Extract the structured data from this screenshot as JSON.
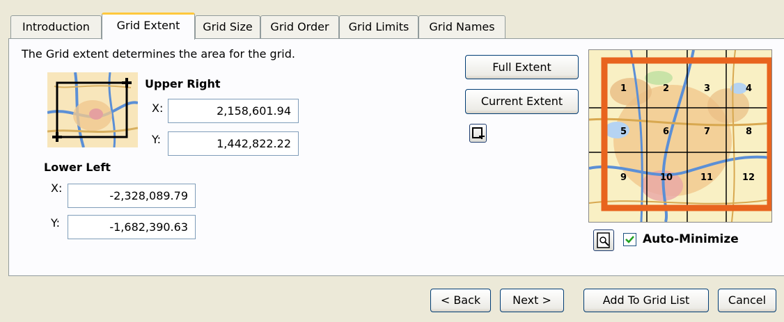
{
  "tabs": [
    "Introduction",
    "Grid Extent",
    "Grid Size",
    "Grid Order",
    "Grid Limits",
    "Grid Names"
  ],
  "active_tab": "Grid Extent",
  "description": "The Grid extent determines the area for the grid.",
  "upper_right": {
    "label": "Upper Right",
    "x_label": "X:",
    "x_value": "2,158,601.94",
    "y_label": "Y:",
    "y_value": "1,442,822.22"
  },
  "lower_left": {
    "label": "Lower Left",
    "x_label": "X:",
    "x_value": "-2,328,089.79",
    "y_label": "Y:",
    "y_value": "-1,682,390.63"
  },
  "buttons": {
    "full_extent": "Full Extent",
    "current_extent": "Current Extent",
    "back": "< Back",
    "next": "Next >",
    "add_to_grid_list": "Add To Grid List",
    "cancel": "Cancel"
  },
  "preview_grid_numbers": [
    "1",
    "2",
    "3",
    "4",
    "5",
    "6",
    "7",
    "8",
    "9",
    "10",
    "11",
    "12"
  ],
  "auto_minimize": {
    "label": "Auto-Minimize",
    "checked": true
  },
  "colors": {
    "grid_outline": "#e8641e",
    "tab_highlight": "#ffc83c",
    "check_mark": "#21a121"
  },
  "icons": [
    "extent-map-icon",
    "select-extent-icon",
    "zoom-preview-icon",
    "checkbox-checked-icon"
  ]
}
